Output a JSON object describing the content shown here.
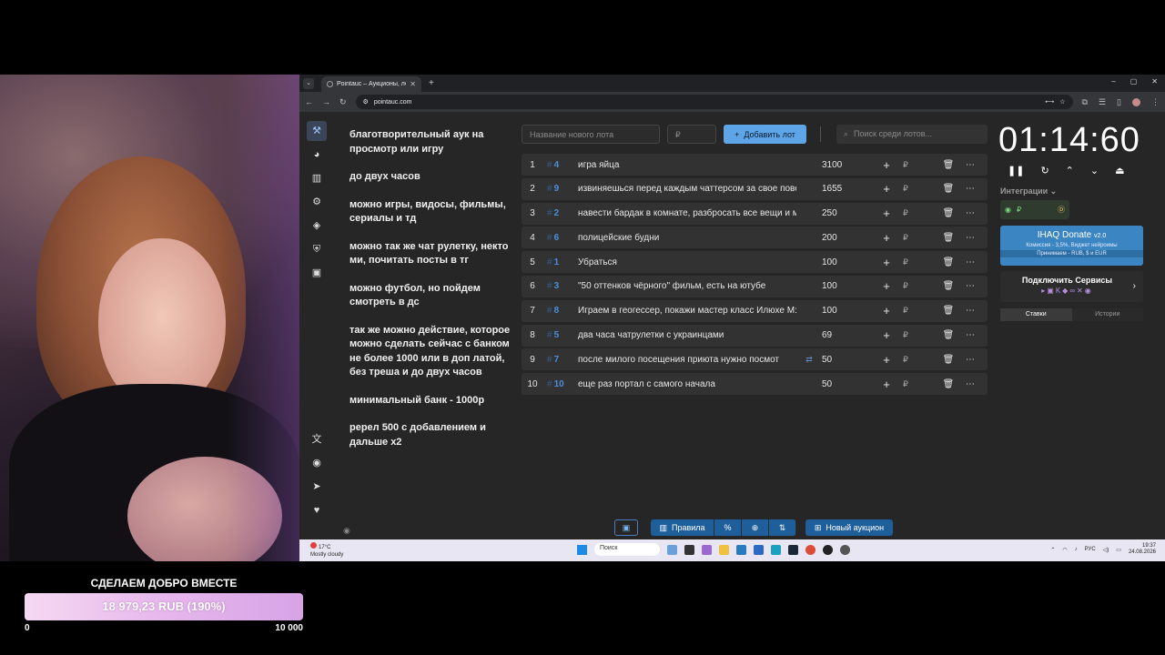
{
  "overlay": {
    "goal_title": "СДЕЛАЕМ ДОБРО ВМЕСТЕ",
    "goal_amount": "18 979,23 RUB (190%)",
    "goal_progress_percent": 190,
    "goal_min": "0",
    "goal_max": "10 000"
  },
  "browser": {
    "tab_title": "Pointauc – Аукционы, лотерей",
    "tab_close": "✕",
    "new_tab": "+",
    "url": "pointauc.com",
    "win_min": "–",
    "win_max": "▢",
    "win_close": "✕"
  },
  "rules": [
    "благотворительный аук на просмотр или игру",
    "до  двух часов",
    "можно игры, видосы, фильмы, сериалы и тд",
    "можно так же чат рулетку, некто ми, почитать посты в тг",
    "можно футбол, но пойдем смотреть в дс",
    "так же можно действие, которое можно сделать сейчас с банком не более 1000 или в доп латой, без треша  и до двух часов",
    "минимальный банк - 1000р",
    "ререл 500 с добавлением и дальше х2"
  ],
  "controls": {
    "lot_name_placeholder": "Название нового лота",
    "amount_placeholder": "₽",
    "add_button": "Добавить лот",
    "search_placeholder": "Поиск среди лотов..."
  },
  "lots": [
    {
      "num": "1",
      "id": "4",
      "name": "игра яйца",
      "amount": "3100",
      "link": ""
    },
    {
      "num": "2",
      "id": "9",
      "name": "извиняешься перед каждым чаттерсом за свое пове",
      "amount": "1655",
      "link": ""
    },
    {
      "num": "3",
      "id": "2",
      "name": "навести бардак в комнате, разбросать все вещи и м",
      "amount": "250",
      "link": ""
    },
    {
      "num": "4",
      "id": "6",
      "name": "полицейские будни",
      "amount": "200",
      "link": ""
    },
    {
      "num": "5",
      "id": "1",
      "name": "Убраться",
      "amount": "100",
      "link": ""
    },
    {
      "num": "6",
      "id": "3",
      "name": "\"50 оттенков чёрного\" фильм, есть на ютубе",
      "amount": "100",
      "link": ""
    },
    {
      "num": "7",
      "id": "8",
      "name": "Играем в геогессер, покажи мастер класс Илюхе М:",
      "amount": "100",
      "link": ""
    },
    {
      "num": "8",
      "id": "5",
      "name": "два часа чатрулетки с украинцами",
      "amount": "69",
      "link": ""
    },
    {
      "num": "9",
      "id": "7",
      "name": "после милого посещения приюта нужно посмот",
      "amount": "50",
      "link": "⇄"
    },
    {
      "num": "10",
      "id": "10",
      "name": "еще раз портал с самого начала",
      "amount": "50",
      "link": ""
    }
  ],
  "bottom": {
    "rules_button": "Правила",
    "new_auction_button": "Новый аукцион"
  },
  "right": {
    "timer": "01:14:60",
    "integrations_label": "Интеграции",
    "ihaq_title": "IHAQ Donate",
    "ihaq_version": "v2.0",
    "ihaq_commission": "Комиссия - 3,5%, Виджет нейроимы",
    "ihaq_accept": "Принимаем - RUB, $ и EUR",
    "services_title": "Подключить Сервисы",
    "tab_bets": "Ставки",
    "tab_history": "Истории"
  },
  "taskbar": {
    "temp": "17°C",
    "weather": "Mostly cloudy",
    "search": "Поиск",
    "lang": "РУС",
    "time": "19:37",
    "date": "24.08.2026"
  }
}
